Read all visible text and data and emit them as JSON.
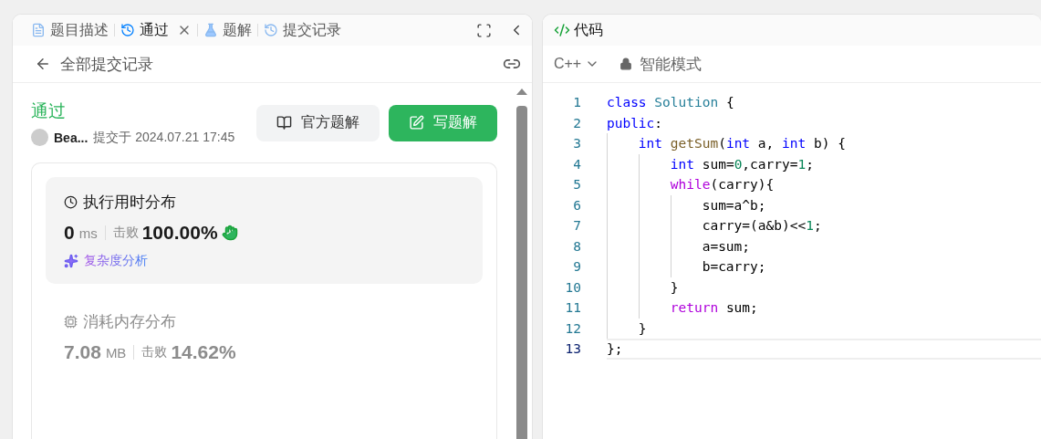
{
  "left_panel": {
    "tabs": [
      {
        "label": "题目描述",
        "selected": false,
        "closable": false
      },
      {
        "label": "通过",
        "selected": true,
        "closable": true
      },
      {
        "label": "题解",
        "selected": false,
        "closable": false
      },
      {
        "label": "提交记录",
        "selected": false,
        "closable": false
      }
    ],
    "back_link": "全部提交记录",
    "submission": {
      "status": "通过",
      "author": "Bea...",
      "submitted": "提交于 2024.07.21 17:45"
    },
    "buttons": [
      {
        "label": "官方题解",
        "kind": "secondary"
      },
      {
        "label": "写题解",
        "kind": "primary"
      }
    ],
    "stats": [
      {
        "title": "执行用时分布",
        "value": "0",
        "unit": "ms",
        "beat_label": "击败",
        "percent": "100.00%",
        "analysis": "复杂度分析",
        "selected": true
      },
      {
        "title": "消耗内存分布",
        "value": "7.08",
        "unit": "MB",
        "beat_label": "击败",
        "percent": "14.62%",
        "selected": false
      }
    ]
  },
  "right_panel": {
    "title": "代码",
    "language": "C++",
    "mode": "智能模式",
    "code": [
      {
        "number": "1",
        "current": false,
        "tokens": [
          {
            "kind": "keyword",
            "text": "class"
          },
          {
            "kind": "type",
            "text": " Solution"
          },
          {
            "kind": "plain",
            "text": " {"
          }
        ]
      },
      {
        "number": "2",
        "current": false,
        "tokens": [
          {
            "kind": "keyword",
            "text": "public"
          },
          {
            "kind": "plain",
            "text": ":"
          }
        ]
      },
      {
        "number": "3",
        "current": false,
        "tokens": [
          {
            "kind": "keyword",
            "text": "    int"
          },
          {
            "kind": "function",
            "text": " getSum"
          },
          {
            "kind": "plain",
            "text": "("
          },
          {
            "kind": "keyword",
            "text": "int"
          },
          {
            "kind": "plain",
            "text": " a, "
          },
          {
            "kind": "keyword",
            "text": "int"
          },
          {
            "kind": "plain",
            "text": " b) {"
          }
        ]
      },
      {
        "number": "4",
        "current": false,
        "tokens": [
          {
            "kind": "keyword",
            "text": "        int"
          },
          {
            "kind": "plain",
            "text": " sum="
          },
          {
            "kind": "number",
            "text": "0"
          },
          {
            "kind": "plain",
            "text": ",carry="
          },
          {
            "kind": "number",
            "text": "1"
          },
          {
            "kind": "plain",
            "text": ";"
          }
        ]
      },
      {
        "number": "5",
        "current": false,
        "tokens": [
          {
            "kind": "control",
            "text": "        while"
          },
          {
            "kind": "plain",
            "text": "(carry){"
          }
        ]
      },
      {
        "number": "6",
        "current": false,
        "tokens": [
          {
            "kind": "plain",
            "text": "            sum=a^b;"
          }
        ]
      },
      {
        "number": "7",
        "current": false,
        "tokens": [
          {
            "kind": "plain",
            "text": "            carry=(a&b)<<"
          },
          {
            "kind": "number",
            "text": "1"
          },
          {
            "kind": "plain",
            "text": ";"
          }
        ]
      },
      {
        "number": "8",
        "current": false,
        "tokens": [
          {
            "kind": "plain",
            "text": "            a=sum;"
          }
        ]
      },
      {
        "number": "9",
        "current": false,
        "tokens": [
          {
            "kind": "plain",
            "text": "            b=carry;"
          }
        ]
      },
      {
        "number": "10",
        "current": false,
        "tokens": [
          {
            "kind": "plain",
            "text": "        }"
          }
        ]
      },
      {
        "number": "11",
        "current": false,
        "tokens": [
          {
            "kind": "control",
            "text": "        return"
          },
          {
            "kind": "plain",
            "text": " sum;"
          }
        ]
      },
      {
        "number": "12",
        "current": false,
        "tokens": [
          {
            "kind": "plain",
            "text": "    }"
          }
        ]
      },
      {
        "number": "13",
        "current": true,
        "tokens": [
          {
            "kind": "plain",
            "text": "};"
          }
        ]
      }
    ]
  }
}
